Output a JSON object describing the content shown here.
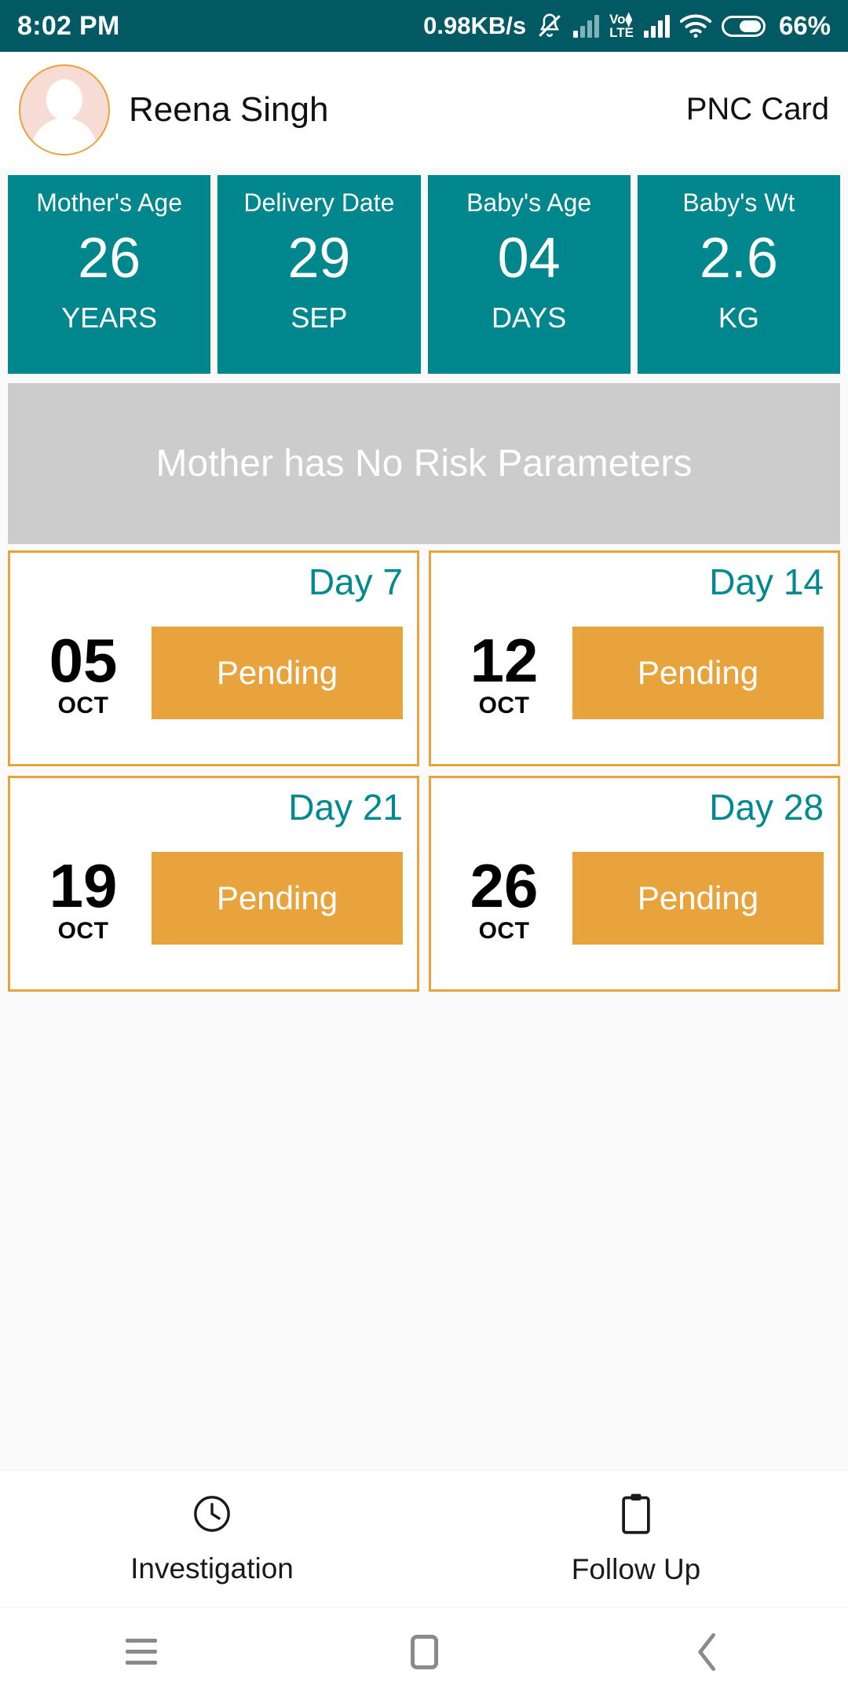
{
  "status_bar": {
    "time": "8:02 PM",
    "network_speed": "0.98KB/s",
    "mute_icon": "bell-muted-icon",
    "signal_icon_1": "signal-bars-icon",
    "volte_top": "Vo⧫",
    "volte_bottom": "LTE",
    "signal_icon_2": "signal-bars-icon",
    "wifi_icon": "wifi-icon",
    "battery_icon": "battery-icon",
    "battery_percent": "66%"
  },
  "header": {
    "avatar": "user-avatar-placeholder",
    "patient_name": "Reena Singh",
    "card_type": "PNC Card"
  },
  "stats": [
    {
      "title": "Mother's Age",
      "value": "26",
      "unit": "YEARS"
    },
    {
      "title": "Delivery Date",
      "value": "29",
      "unit": "SEP"
    },
    {
      "title": "Baby's Age",
      "value": "04",
      "unit": "DAYS"
    },
    {
      "title": "Baby's Wt",
      "value": "2.6",
      "unit": "KG"
    }
  ],
  "risk_banner": {
    "text": "Mother has No Risk Parameters"
  },
  "visits": [
    {
      "day_label": "Day 7",
      "date_number": "05",
      "date_month": "OCT",
      "status": "Pending"
    },
    {
      "day_label": "Day 14",
      "date_number": "12",
      "date_month": "OCT",
      "status": "Pending"
    },
    {
      "day_label": "Day 21",
      "date_number": "19",
      "date_month": "OCT",
      "status": "Pending"
    },
    {
      "day_label": "Day 28",
      "date_number": "26",
      "date_month": "OCT",
      "status": "Pending"
    }
  ],
  "bottom_bar": [
    {
      "label": "Investigation",
      "icon": "clock-icon"
    },
    {
      "label": "Follow Up",
      "icon": "clipboard-icon"
    }
  ],
  "android_nav": {
    "menu": "menu-icon",
    "home": "home-square-icon",
    "back": "back-chevron-icon"
  },
  "colors": {
    "status_bar": "#015A63",
    "teal": "#00868D",
    "teal_text": "#00898F",
    "orange": "#E8A33D",
    "risk_gray": "#CCCCCC",
    "avatar_bg": "#F6DCD4",
    "page_bg": "#FAFAFA"
  }
}
